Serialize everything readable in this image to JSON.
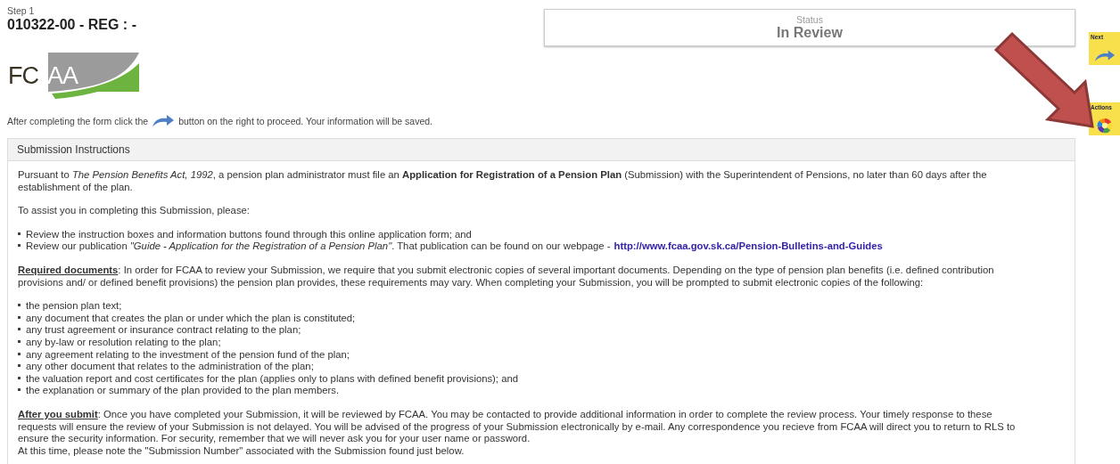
{
  "header": {
    "step": "Step 1",
    "title": "010322-00 - REG : -"
  },
  "status": {
    "label": "Status",
    "value": "In Review"
  },
  "logo": {
    "dark_text": "FC",
    "light_text": "AA"
  },
  "instruction": {
    "before": "After completing the form click the",
    "after": "button on the right to proceed. Your information will be saved."
  },
  "side_buttons": [
    {
      "label": "Next",
      "kind": "next"
    },
    {
      "label": "Actions",
      "kind": "actions"
    }
  ],
  "panel": {
    "title": "Submission Instructions",
    "blocks": [
      {
        "kind": "paragraph",
        "text": "Pursuant to *The Pension Benefits Act, 1992*, a pension plan administrator must file an **Application for Registration of a Pension Plan** (Submission) with the Superintendent of Pensions, no later than 60 days after the establishment of the plan."
      },
      {
        "kind": "paragraph",
        "text": "To assist you in completing this Submission, please:"
      },
      {
        "kind": "list",
        "items": [
          {
            "text": "Review the instruction boxes and information buttons found through this online application form; and"
          },
          {
            "text": "Review our publication *\"Guide - Application for the Registration of a Pension Plan\"*. That publication can be found on our webpage -",
            "link": "http://www.fcaa.gov.sk.ca/Pension-Bulletins-and-Guides"
          }
        ]
      },
      {
        "kind": "lead",
        "text": "**Required documents**: In order for FCAA to review your Submission, we require that you submit electronic copies of several important documents. Depending on the type of pension plan benefits (i.e. defined contribution provisions and/ or defined benefit provisions) the pension plan provides, these requirements may vary. When completing your Submission, you will be prompted to submit electronic copies of the following:"
      },
      {
        "kind": "list",
        "items": [
          {
            "text": "the pension plan text;"
          },
          {
            "text": "any document that creates the plan or under which the plan is constituted;"
          },
          {
            "text": "any trust agreement or insurance contract relating to the plan;"
          },
          {
            "text": "any by-law or resolution relating to the plan;"
          },
          {
            "text": "any agreement relating to the investment of the pension fund of the plan;"
          },
          {
            "text": "any other document that relates to the administration of the plan;"
          },
          {
            "text": "the valuation report and cost certificates for the plan (applies only to plans with defined benefit provisions); and"
          },
          {
            "text": "the explanation or summary of the plan provided to the plan members."
          }
        ]
      },
      {
        "kind": "lead",
        "text": "**After you submit**: Once you have completed your Submission, it will be reviewed by FCAA. You may be contacted to provide additional information in order to complete the review process. Your timely response to these requests will ensure the review of your Submission is not delayed. You will be advised of the progress of your Submission electronically by e-mail. Any correspondence you recieve from FCAA will direct you to return to RLS to ensure the security information. For security, remember that we will never ask you for your user name or password."
      },
      {
        "kind": "line",
        "text": "At this time, please note the \"Submission Number\" associated with the Submission found just below."
      }
    ]
  }
}
